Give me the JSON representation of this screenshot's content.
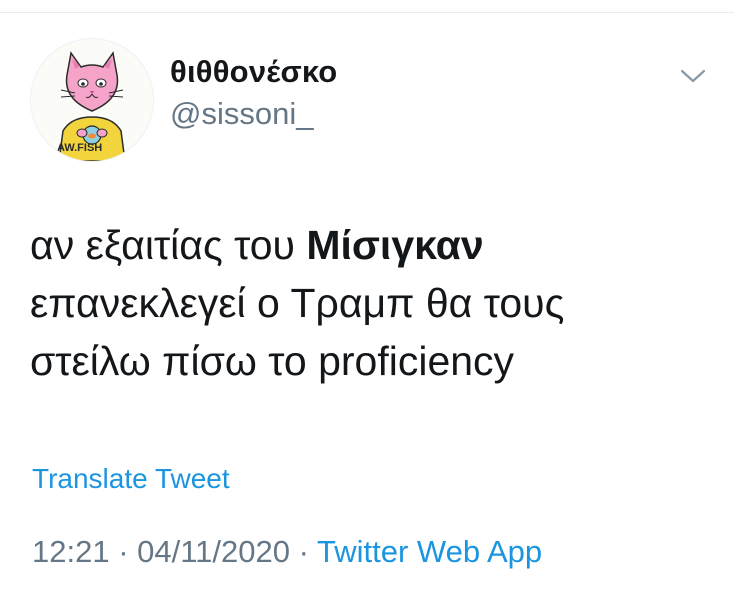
{
  "author": {
    "display_name": "θιθθονέσκο",
    "handle": "@sissoni_",
    "avatar_caption": "AW.FISH"
  },
  "tweet": {
    "text_line1_prefix": "αν εξαιτίας του ",
    "text_line1_bold": "Μίσιγκαν",
    "text_line2": "επανεκλεγεί ο Τραμπ θα τους",
    "text_line3": "στείλω πίσω το proficiency",
    "translate_label": "Translate Tweet",
    "time": "12:21",
    "separator": " · ",
    "date": "04/11/2020",
    "source": "Twitter Web App"
  },
  "icons": {
    "caret": "chevron-down-icon"
  },
  "colors": {
    "text_primary": "#14171a",
    "text_secondary": "#657786",
    "link_blue": "#1b95e0",
    "divider": "#e6ecf0"
  }
}
